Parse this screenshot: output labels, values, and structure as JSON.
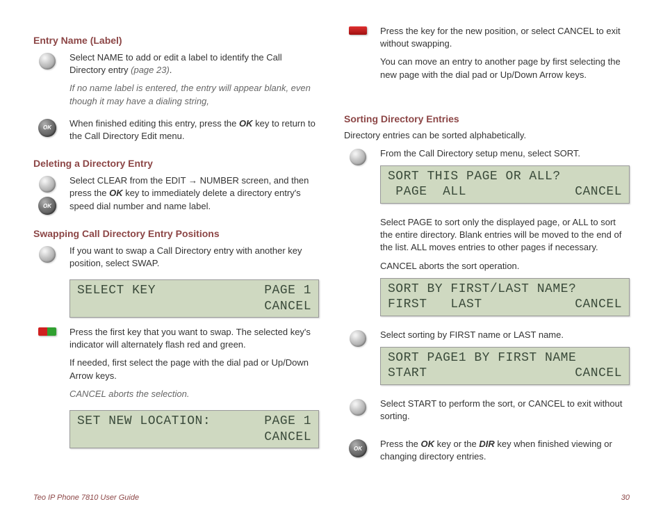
{
  "leftCol": {
    "h1": "Entry Name (Label)",
    "p1a": "Select NAME to add or edit a label to identify the Call Directory entry ",
    "p1b": "(page 23)",
    "p1c": ".",
    "p2": "If no name label is entered, the entry will appear blank, even though it may have a dialing string,",
    "p3a": "When finished editing this entry, press the ",
    "p3b": "OK",
    "p3c": " key to return to the Call Directory Edit menu.",
    "h2": "Deleting a Directory Entry",
    "p4a": "Select CLEAR from the EDIT → NUMBER screen, and then press the ",
    "p4b": "OK",
    "p4c": " key to immediately delete a directory entry's speed dial number and name label.",
    "h3": "Swapping Call Directory Entry Positions",
    "p5": "If you want to swap a Call Directory entry with another key position, select SWAP.",
    "lcd1": {
      "r1l": "SELECT KEY",
      "r1r": "PAGE 1",
      "r2l": "",
      "r2r": "CANCEL"
    },
    "p6": "Press the first key that you want to swap. The selected key's indicator will alternately flash red and green.",
    "p7": "If needed, first select the page with the dial pad or Up/Down Arrow keys.",
    "p8": "CANCEL aborts the selection.",
    "lcd2": {
      "r1l": "SET NEW LOCATION:",
      "r1r": "PAGE 1",
      "r2l": "",
      "r2r": "CANCEL"
    }
  },
  "rightCol": {
    "p1": "Press the key for the new position, or select CANCEL to exit without swapping.",
    "p2": "You can move an entry to another page by first selecting the new page with the dial pad or Up/Down Arrow keys.",
    "h1": "Sorting Directory Entries",
    "p3": "Directory entries can be sorted alphabetically.",
    "p4": "From the Call Directory setup menu, select SORT.",
    "lcd1": {
      "r1l": "SORT THIS PAGE OR ALL?",
      "r1r": "",
      "r2l": " PAGE  ALL",
      "r2r": "CANCEL"
    },
    "p5": "Select PAGE to sort only the displayed page, or ALL to sort the entire directory. Blank entries will be moved to the end of the list. ALL moves entries to other pages if necessary.",
    "p6": "CANCEL aborts the sort operation.",
    "lcd2": {
      "r1l": "SORT BY FIRST/LAST NAME?",
      "r1r": "",
      "r2l": "FIRST   LAST",
      "r2r": "CANCEL"
    },
    "p7": "Select sorting by FIRST name or LAST name.",
    "lcd3": {
      "r1l": "SORT PAGE1 BY FIRST NAME",
      "r1r": "",
      "r2l": "START",
      "r2r": "CANCEL"
    },
    "p8": "Select START to perform the sort, or CANCEL to exit without sorting.",
    "p9a": "Press the ",
    "p9b": "OK",
    "p9c": " key or the ",
    "p9d": "DIR",
    "p9e": " key when finished viewing or changing directory entries."
  },
  "footer": {
    "left": "Teo IP Phone 7810 User Guide",
    "right": "30"
  },
  "labels": {
    "ok": "OK"
  }
}
